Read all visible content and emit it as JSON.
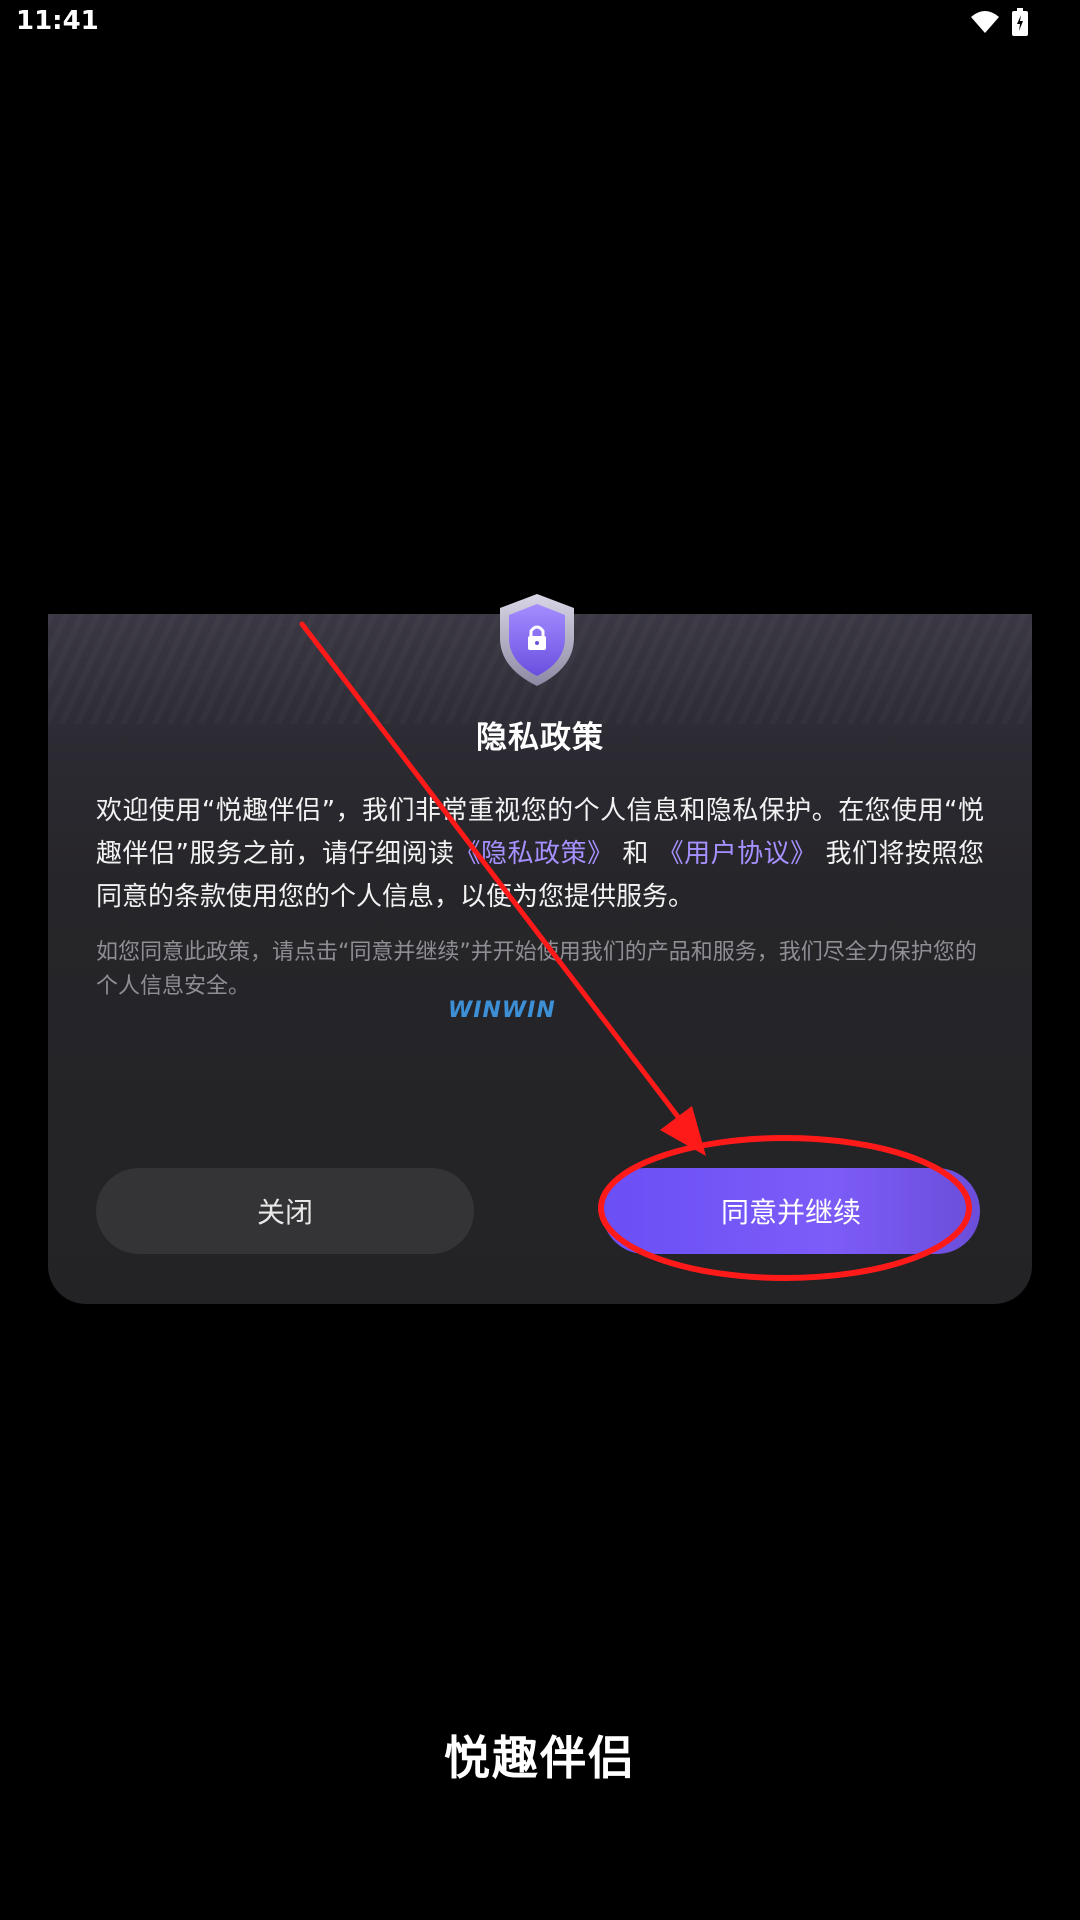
{
  "status_bar": {
    "time": "11:41",
    "icons": [
      "wifi-icon",
      "battery-icon"
    ]
  },
  "dialog": {
    "icon": "shield-lock-icon",
    "title": "隐私政策",
    "body": {
      "part1": "欢迎使用“悦趣伴侣”，我们非常重视您的个人信息和隐私保护。在您使用“悦趣伴侣”服务之前，请仔细阅读",
      "privacy_link": "《隐私政策》",
      "and": "和",
      "user_agreement_link": "《用户协议》",
      "part2": "我们将按照您同意的条款使用您的个人信息，以便为您提供服务。"
    },
    "note": {
      "part1": "如您同意此政策，请点击“同意并继续”并开始使用我们的产品和服务，我们尽全力保护您",
      "part2": "的个人信息安全。"
    },
    "watermark": "WINWIN",
    "close_button": "关闭",
    "agree_button": "同意并继续"
  },
  "app_name": "悦趣伴侣",
  "colors": {
    "background": "#000000",
    "dialog": "#262529",
    "accent": "#7d5cf8",
    "link": "#a790ff",
    "annotation": "#ff0000"
  }
}
